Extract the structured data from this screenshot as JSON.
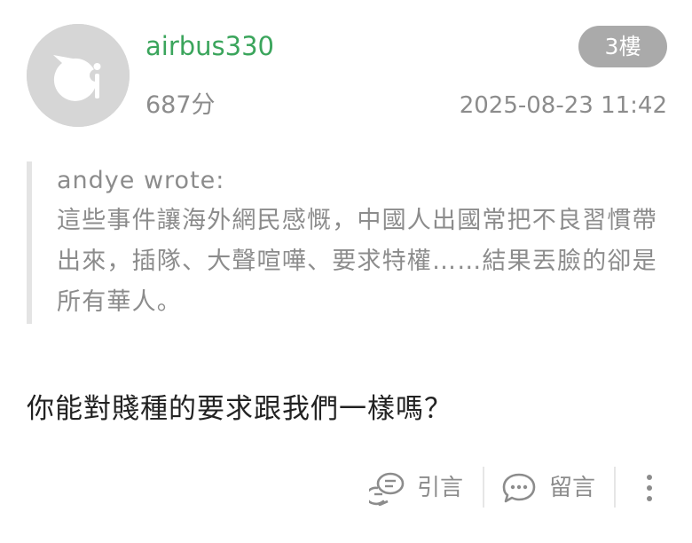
{
  "post": {
    "username": "airbus330",
    "points": "687分",
    "floor": "3樓",
    "timestamp": "2025-08-23 11:42",
    "quote": {
      "author": "andye wrote:",
      "text": "這些事件讓海外網民感慨，中國人出國常把不良習慣帶出來，插隊、大聲喧嘩、要求特權……結果丟臉的卻是所有華人。"
    },
    "reply": "你能對賤種的要求跟我們一樣嗎？"
  },
  "actions": {
    "quote_label": "引言",
    "comment_label": "留言"
  },
  "colors": {
    "username": "#3ba55c",
    "badge_bg": "#aaaaaa",
    "muted_text": "#8c8c8c",
    "body_text": "#222222"
  },
  "icons": [
    "avatar-default-icon",
    "quote-bubbles-icon",
    "comment-bubble-icon",
    "more-vertical-icon"
  ]
}
